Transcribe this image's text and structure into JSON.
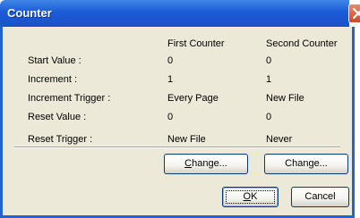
{
  "window": {
    "title": "Counter"
  },
  "headers": {
    "first": "First Counter",
    "second": "Second Counter"
  },
  "rows": [
    {
      "label": "Start Value :",
      "first": "0",
      "second": "0"
    },
    {
      "label": "Increment :",
      "first": "1",
      "second": "1"
    },
    {
      "label": "Increment Trigger :",
      "first": "Every Page",
      "second": "New File"
    },
    {
      "label": "Reset Value :",
      "first": "0",
      "second": "0"
    },
    {
      "label": "Reset Trigger :",
      "first": "New File",
      "second": "Never"
    }
  ],
  "buttons": {
    "change_first": {
      "mnemonic": "C",
      "rest": "hange..."
    },
    "change_second": {
      "pre": "Chan",
      "mnemonic": "g",
      "rest": "e..."
    },
    "ok": {
      "mnemonic": "O",
      "rest": "K"
    },
    "cancel": "Cancel"
  },
  "icons": {
    "close": "close-x-icon"
  },
  "colors": {
    "titlebar": "#1c5bd7",
    "client": "#ece9d8",
    "close": "#c94a26"
  }
}
